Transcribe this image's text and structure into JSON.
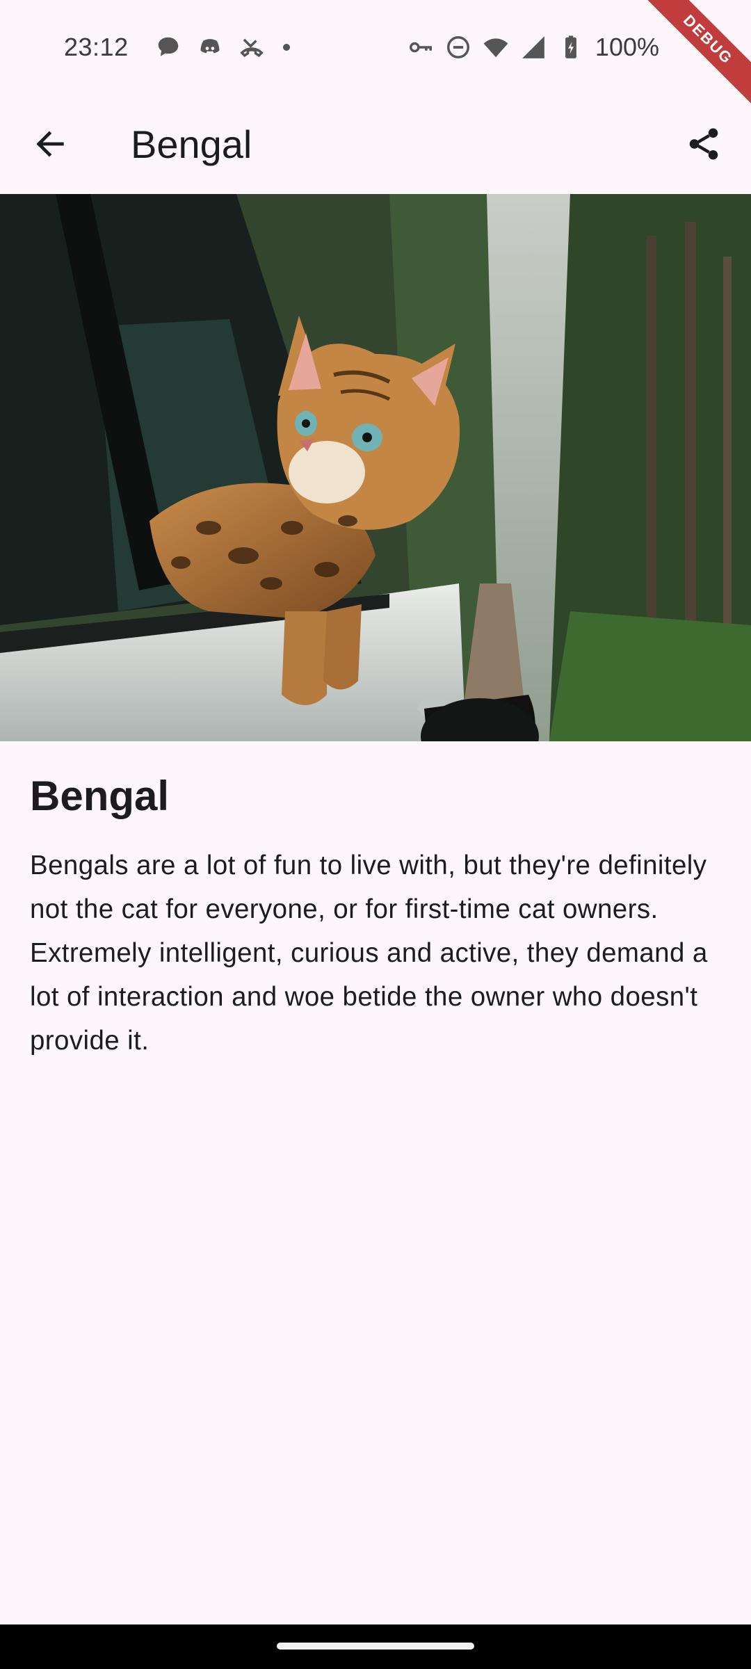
{
  "status_bar": {
    "time": "23:12",
    "battery": "100%",
    "left_icons": [
      "chat-bubble-icon",
      "discord-icon",
      "missed-call-icon",
      "notification-dot-icon"
    ],
    "right_icons": [
      "vpn-key-icon",
      "do-not-disturb-icon",
      "wifi-icon",
      "cellular-signal-icon",
      "battery-charging-icon"
    ]
  },
  "debug_banner": "DEBUG",
  "app_bar": {
    "title": "Bengal",
    "back_icon": "arrow-back-icon",
    "share_icon": "share-icon"
  },
  "hero_image": {
    "subject": "Bengal cat leaning out of a car window on a forest road"
  },
  "breed": {
    "name": "Bengal",
    "description": "Bengals are a lot of fun to live with, but they're definitely not the cat for everyone, or for first-time cat owners. Extremely intelligent, curious and active, they demand a lot of interaction and woe betide the owner who doesn't provide it."
  },
  "colors": {
    "background": "#fdf7fc",
    "text": "#1c1b1f",
    "debug_banner": "#b71c1c"
  }
}
